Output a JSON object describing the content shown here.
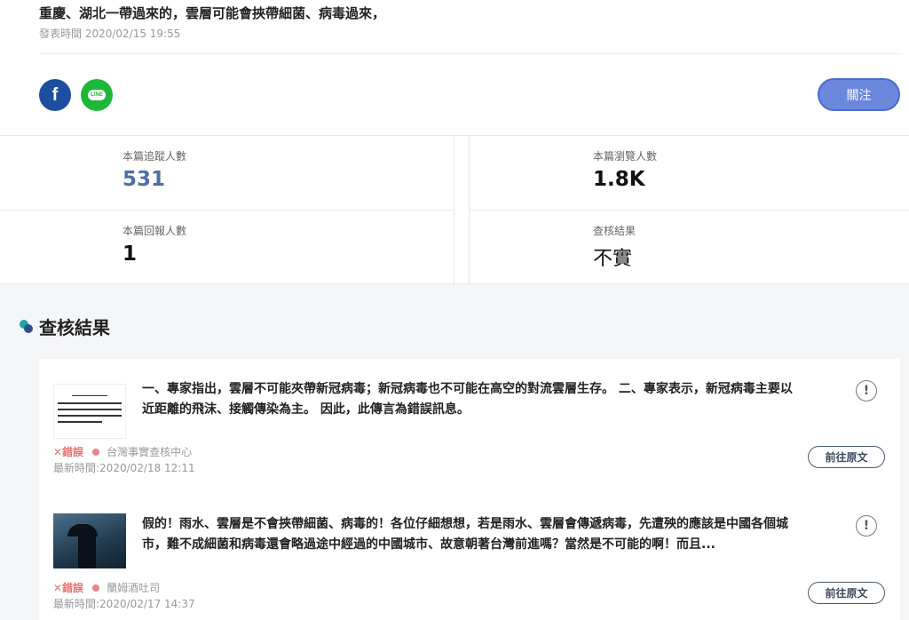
{
  "post": {
    "message": "重慶、湖北一帶過來的，雲層可能會挾帶細菌、病毒過來，",
    "time": "發表時間 2020/02/15 19:55"
  },
  "social": {
    "facebook_label": "f",
    "line_label": "LINE"
  },
  "follow_label": "關注",
  "stats": [
    {
      "label": "本篇追蹤人數",
      "value": "531"
    },
    {
      "label": "本篇瀏覽人數",
      "value": "1.8K"
    },
    {
      "label": "本篇回報人數",
      "value": "1"
    },
    {
      "label": "查核結果",
      "value": "不實"
    }
  ],
  "section_title": "查核結果",
  "results": [
    {
      "summary": "一、專家指出，雲層不可能夾帶新冠病毒；新冠病毒也不可能在高空的對流雲層生存。 二、專家表示，新冠病毒主要以近距離的飛沫、接觸傳染為主。 因此，此傳言為錯誤訊息。",
      "verdict": "✕錯誤",
      "source": "台灣事實查核中心",
      "updated": "最新時間:2020/02/18 12:11",
      "button": "前往原文",
      "alert": "!"
    },
    {
      "summary": "假的！雨水、雲層是不會挾帶細菌、病毒的！各位仔細想想，若是雨水、雲層會傳遞病毒，先遭殃的應該是中國各個城市，難不成細菌和病毒還會略過途中經過的中國城市、故意朝著台灣前進嗎？當然是不可能的啊！而且...",
      "verdict": "✕錯誤",
      "source": "蘭姆酒吐司",
      "updated": "最新時間:2020/02/17 14:37",
      "button": "前往原文",
      "alert": "!"
    }
  ],
  "colors": {
    "accent": "#6b88dd",
    "follow_count": "#4d6ea8",
    "error": "#e57373",
    "facebook": "#1d4ea0",
    "line": "#1db83a"
  }
}
